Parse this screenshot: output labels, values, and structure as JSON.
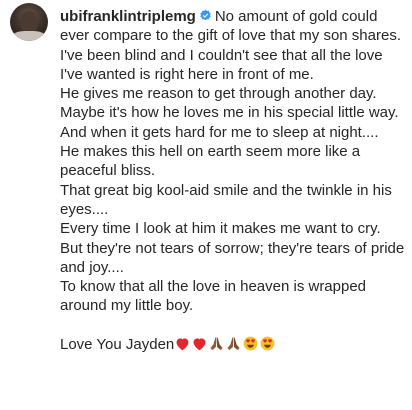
{
  "post": {
    "username": "ubifranklintriplemg",
    "caption_lines": [
      "No amount of gold could ever compare to the gift of love that my son shares.",
      "I've been blind and I couldn't see that all the love I've wanted is right here in front of me.",
      "He gives me reason to get through another day.",
      "Maybe it's how he loves me in his special little way.",
      "And when it gets hard for me to sleep at night....",
      "He makes this hell on earth seem more like a peaceful bliss.",
      "That great big kool-aid smile and the twinkle in his eyes....",
      "Every time I look at him it makes me want to cry.",
      "But they're not tears of sorrow; they're tears of pride and joy....",
      "To know that all the love in heaven is wrapped around my little boy."
    ],
    "signoff": "Love You Jayden",
    "emojis": [
      "red-heart-icon",
      "red-heart-icon",
      "folded-hands-icon",
      "folded-hands-icon",
      "heart-eyes-face-icon",
      "heart-eyes-face-icon"
    ]
  },
  "colors": {
    "text": "#262626",
    "verified_badge": "#3897f0",
    "heart": "#e0262e",
    "hands": "#8a5a35",
    "emoji_face": "#f5c026"
  }
}
